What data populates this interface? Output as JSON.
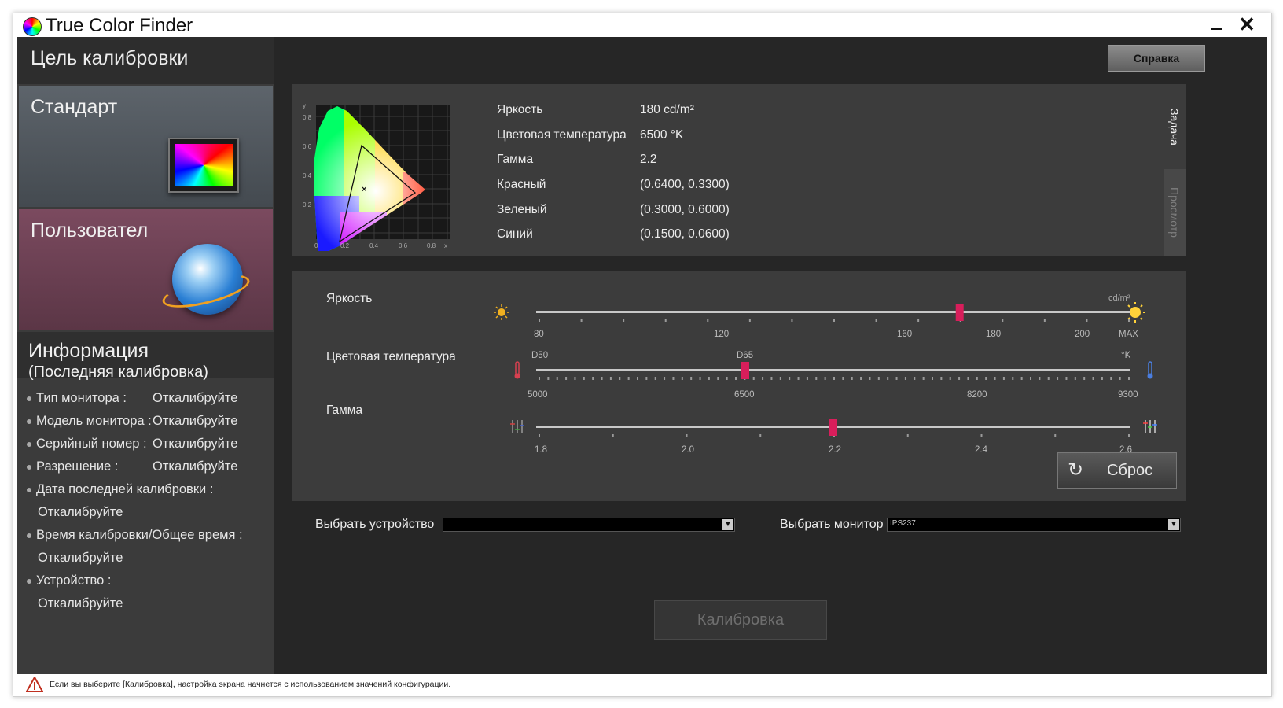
{
  "window": {
    "title": "True Color Finder"
  },
  "sidebar": {
    "header": "Цель калибровки",
    "cards": [
      {
        "label": "Стандарт",
        "icon": "monitor-icon"
      },
      {
        "label": "Пользовател",
        "icon": "globe-icon"
      }
    ],
    "info": {
      "title": "Информация",
      "subtitle": "(Последняя калибровка)",
      "rows": [
        {
          "label": "Тип монитора :",
          "value": "Откалибруйте"
        },
        {
          "label": "Модель монитора :",
          "value": "Откалибруйте"
        },
        {
          "label": "Серийный номер :",
          "value": "Откалибруйте"
        },
        {
          "label": "Разрешение :",
          "value": "Откалибруйте"
        },
        {
          "label": "Дата последней калибровки :",
          "value": "Откалибруйте"
        },
        {
          "label": "Время калибровки/Общее время :",
          "value": "Откалибруйте"
        },
        {
          "label": "Устройство :",
          "value": "Откалибруйте"
        }
      ]
    }
  },
  "header": {
    "help_label": "Справка"
  },
  "tabs": {
    "task": "Задача",
    "view": "Просмотр"
  },
  "cie": {
    "y_label": "y",
    "x_label": "x",
    "y_ticks": [
      "0.8",
      "0.6",
      "0.4",
      "0.2"
    ],
    "x_ticks": [
      "0",
      "0.2",
      "0.4",
      "0.6",
      "0.8"
    ]
  },
  "target": {
    "rows": [
      {
        "label": "Яркость",
        "value": "180 cd/m²"
      },
      {
        "label": "Цветовая температура",
        "value": "6500 °K"
      },
      {
        "label": "Гамма",
        "value": "2.2"
      },
      {
        "label": "Красный",
        "value": "(0.6400, 0.3300)"
      },
      {
        "label": "Зеленый",
        "value": "(0.3000, 0.6000)"
      },
      {
        "label": "Синий",
        "value": "(0.1500, 0.0600)"
      }
    ]
  },
  "sliders": {
    "brightness": {
      "label": "Яркость",
      "unit": "cd/m²",
      "value": 180,
      "min": 80,
      "max": 220,
      "ticks": [
        "80",
        "120",
        "160",
        "180",
        "200",
        "MAX"
      ]
    },
    "temperature": {
      "label": "Цветовая температура",
      "unit": "°K",
      "value": 6500,
      "presets": [
        "D50",
        "D65"
      ],
      "ticks": [
        "5000",
        "6500",
        "8200",
        "9300"
      ]
    },
    "gamma": {
      "label": "Гамма",
      "value": 2.2,
      "min": 1.8,
      "max": 2.6,
      "ticks": [
        "1.8",
        "2.0",
        "2.2",
        "2.4",
        "2.6"
      ]
    },
    "accent": "#d81e5b"
  },
  "reset_label": "Сброс",
  "device": {
    "label": "Выбрать устройство",
    "value": ""
  },
  "monitor": {
    "label": "Выбрать монитор",
    "value": "IPS237"
  },
  "calibrate_label": "Калибровка",
  "status": "Если вы выберите [Калибровка], настройка экрана начнется с использованием значений конфигурации."
}
